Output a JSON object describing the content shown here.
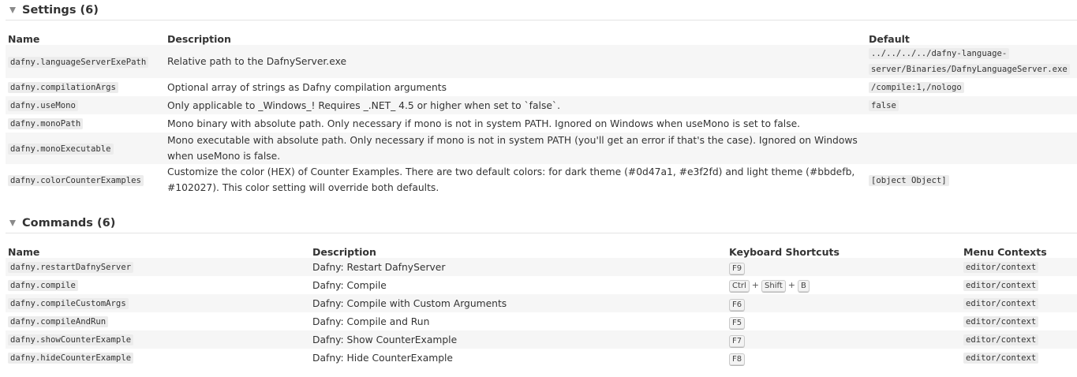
{
  "settings": {
    "title": "Settings (6)",
    "columns": {
      "name": "Name",
      "description": "Description",
      "default": "Default"
    },
    "rows": [
      {
        "name": "dafny.languageServerExePath",
        "description": "Relative path to the DafnyServer.exe",
        "default_line1": "../../../../dafny-language-",
        "default_line2": "server/Binaries/DafnyLanguageServer.exe"
      },
      {
        "name": "dafny.compilationArgs",
        "description": "Optional array of strings as Dafny compilation arguments",
        "default": "/compile:1,/nologo"
      },
      {
        "name": "dafny.useMono",
        "description": "Only applicable to _Windows_! Requires _.NET_ 4.5 or higher when set to `false`.",
        "default": "false"
      },
      {
        "name": "dafny.monoPath",
        "description": "Mono binary with absolute path. Only necessary if mono is not in system PATH. Ignored on Windows when useMono is set to false.",
        "default": ""
      },
      {
        "name": "dafny.monoExecutable",
        "description": "Mono executable with absolute path. Only necessary if mono is not in system PATH (you'll get an error if that's the case). Ignored on Windows when useMono is false.",
        "default": ""
      },
      {
        "name": "dafny.colorCounterExamples",
        "description": "Customize the color (HEX) of Counter Examples. There are two default colors: for dark theme (#0d47a1, #e3f2fd) and light theme (#bbdefb, #102027). This color setting will override both defaults.",
        "default": "[object Object]"
      }
    ]
  },
  "commands": {
    "title": "Commands (6)",
    "columns": {
      "name": "Name",
      "description": "Description",
      "shortcuts": "Keyboard Shortcuts",
      "menus": "Menu Contexts"
    },
    "rows": [
      {
        "name": "dafny.restartDafnyServer",
        "description": "Dafny: Restart DafnyServer",
        "keys": [
          "F9"
        ],
        "menu": "editor/context"
      },
      {
        "name": "dafny.compile",
        "description": "Dafny: Compile",
        "keys": [
          "Ctrl",
          "Shift",
          "B"
        ],
        "menu": "editor/context"
      },
      {
        "name": "dafny.compileCustomArgs",
        "description": "Dafny: Compile with Custom Arguments",
        "keys": [
          "F6"
        ],
        "menu": "editor/context"
      },
      {
        "name": "dafny.compileAndRun",
        "description": "Dafny: Compile and Run",
        "keys": [
          "F5"
        ],
        "menu": "editor/context"
      },
      {
        "name": "dafny.showCounterExample",
        "description": "Dafny: Show CounterExample",
        "keys": [
          "F7"
        ],
        "menu": "editor/context"
      },
      {
        "name": "dafny.hideCounterExample",
        "description": "Dafny: Hide CounterExample",
        "keys": [
          "F8"
        ],
        "menu": "editor/context"
      }
    ]
  },
  "icons": {
    "collapse": "chevron-down-icon"
  },
  "colors": {
    "row_alt": "#f6f6f6",
    "code_bg": "#ececec",
    "text": "#333333"
  }
}
